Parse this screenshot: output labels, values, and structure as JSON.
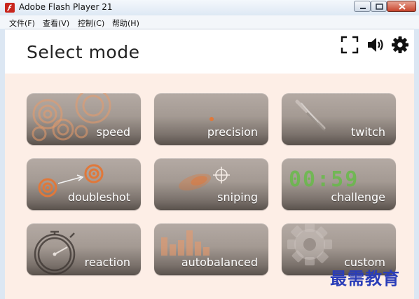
{
  "window": {
    "title": "Adobe Flash Player 21",
    "menus": [
      "文件(F)",
      "查看(V)",
      "控制(C)",
      "帮助(H)"
    ]
  },
  "header": {
    "title": "Select mode",
    "icons": [
      "fullscreen-icon",
      "volume-icon",
      "settings-gear-icon"
    ]
  },
  "modes": [
    {
      "label": "speed"
    },
    {
      "label": "precision"
    },
    {
      "label": "twitch"
    },
    {
      "label": "doubleshot"
    },
    {
      "label": "sniping"
    },
    {
      "label": "challenge",
      "timer": "00:59"
    },
    {
      "label": "reaction"
    },
    {
      "label": "autobalanced"
    },
    {
      "label": "custom"
    }
  ],
  "watermark": "最需教育",
  "colors": {
    "content_bg": "#fdeee6",
    "tile_top": "#b4aaa4",
    "tile_bottom": "#5a524d",
    "accent_orange": "#e0783a",
    "timer_green": "#5fbf3f",
    "watermark_blue": "#2a3db8"
  }
}
